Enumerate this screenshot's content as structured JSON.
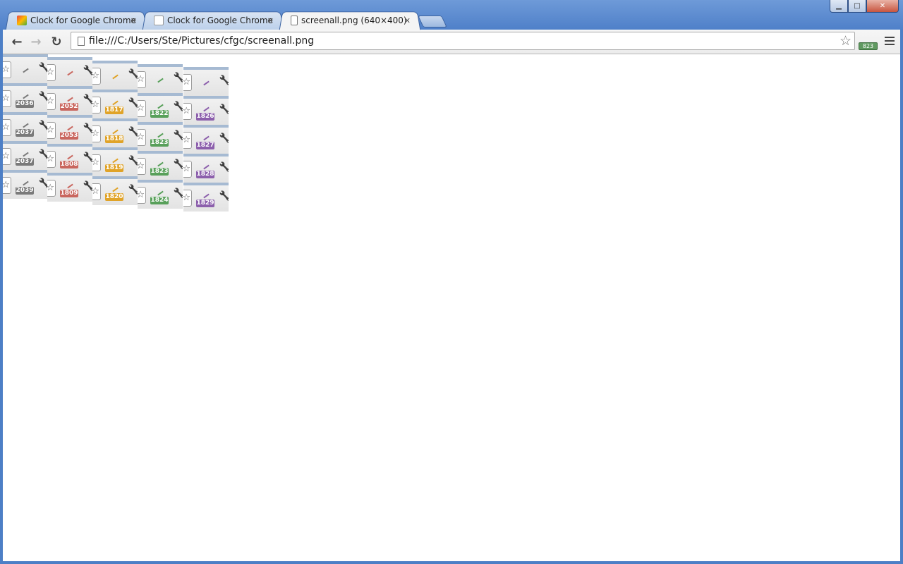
{
  "window": {
    "minimize_glyph": "▁",
    "maximize_glyph": "□",
    "close_glyph": "✕"
  },
  "tabs": [
    {
      "title": "Clock for Google Chrome",
      "icon": "web-store-icon",
      "active": false
    },
    {
      "title": "Clock for Google Chrome",
      "icon": "gmail-icon",
      "active": false
    },
    {
      "title": "screenall.png (640×400)",
      "icon": "page-icon",
      "active": true
    }
  ],
  "tab_close_glyph": "✕",
  "toolbar": {
    "back_glyph": "←",
    "forward_glyph": "→",
    "reload_glyph": "↻",
    "url": "file:///C:/Users/Ste/Pictures/cfgc/screenall.png",
    "star_glyph": "☆",
    "extension_badge": "823"
  },
  "sprite_glyphs": {
    "star": "☆",
    "wrench": "🔧"
  },
  "sprite_columns": [
    {
      "color": "#7a7a7a",
      "badges": [
        "",
        "2036",
        "2037",
        "2037",
        "2039"
      ]
    },
    {
      "color": "#c9665e",
      "badges": [
        "",
        "2052",
        "2053",
        "1808",
        "1809"
      ]
    },
    {
      "color": "#e0a328",
      "badges": [
        "",
        "1817",
        "1818",
        "1819",
        "1820"
      ]
    },
    {
      "color": "#58a05a",
      "badges": [
        "",
        "1822",
        "1823",
        "1823",
        "1824"
      ]
    },
    {
      "color": "#8c5fac",
      "badges": [
        "",
        "1826",
        "1827",
        "1828",
        "1829"
      ]
    }
  ]
}
